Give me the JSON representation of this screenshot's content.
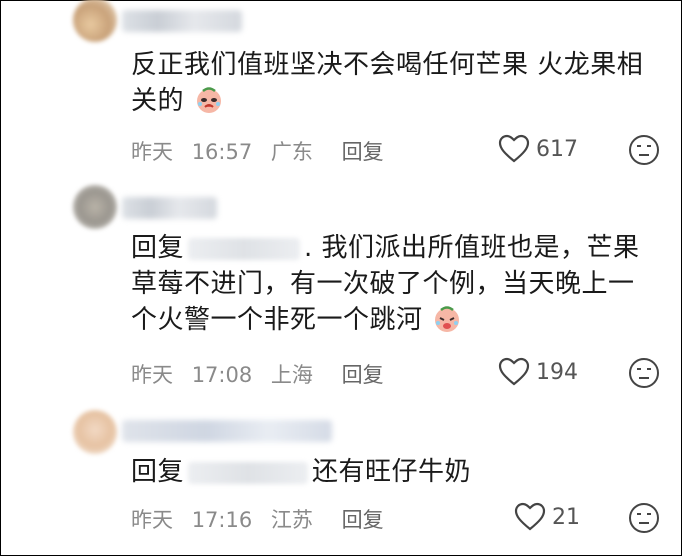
{
  "comments": [
    {
      "text": "反正我们值班坚决不会喝任何芒果 火龙果相关的",
      "meta": {
        "date": "昨天",
        "time": "16:57",
        "location": "广东",
        "reply_label": "回复"
      },
      "likes": "617",
      "emoji": "crying-face"
    },
    {
      "reply_prefix": "回复",
      "text": ". 我们派出所值班也是，芒果草莓不进门，有一次破了个例，当天晚上一个火警一个非死一个跳河",
      "meta": {
        "date": "昨天",
        "time": "17:08",
        "location": "上海",
        "reply_label": "回复"
      },
      "likes": "194",
      "emoji": "crying-face"
    },
    {
      "reply_prefix": "回复",
      "text": "还有旺仔牛奶",
      "meta": {
        "date": "昨天",
        "time": "17:16",
        "location": "江苏",
        "reply_label": "回复"
      },
      "likes": "21"
    }
  ]
}
